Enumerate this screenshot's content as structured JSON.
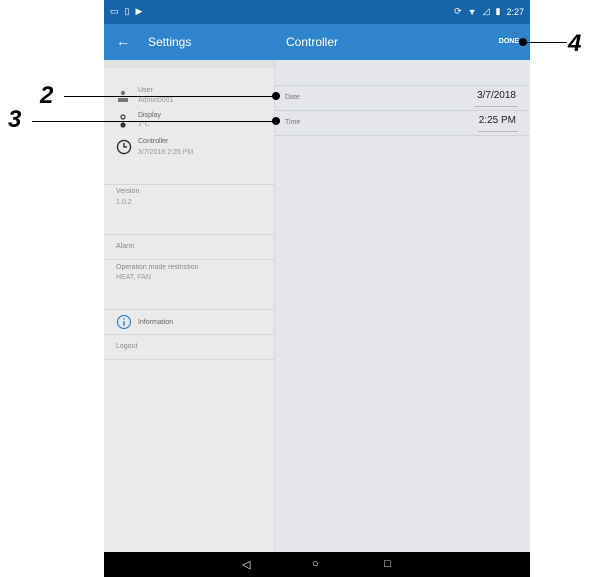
{
  "statusbar": {
    "time": "2:27",
    "left_icons": [
      "notification-icon",
      "sdcard-icon",
      "play-store-icon"
    ],
    "right_icons": [
      "sync-icon",
      "wifi-icon",
      "signal-icon",
      "battery-icon"
    ]
  },
  "appbar": {
    "back_icon": "←",
    "settings_title": "Settings",
    "controller_title": "Controller",
    "done_label": "DONE"
  },
  "sidebar": {
    "user": {
      "label": "User",
      "value": "Admin0001"
    },
    "display": {
      "label": "Display",
      "value": "1°C"
    },
    "controller": {
      "label": "Controller",
      "value": "3/7/2018 2:25 PM"
    },
    "version": {
      "label": "Version",
      "value": "1.0.2"
    },
    "alarm": {
      "label": "Alarm"
    },
    "operation": {
      "label": "Operation mode restriction",
      "value": "HEAT, FAN"
    },
    "information": {
      "label": "Information"
    },
    "logout": {
      "label": "Logout"
    }
  },
  "detail": {
    "date": {
      "label": "Date",
      "value": "3/7/2018"
    },
    "time": {
      "label": "Time",
      "value": "2:25 PM"
    }
  },
  "navbar": {
    "back": "◁",
    "home": "○",
    "recent": "□"
  },
  "callouts": [
    "2",
    "3",
    "4"
  ]
}
